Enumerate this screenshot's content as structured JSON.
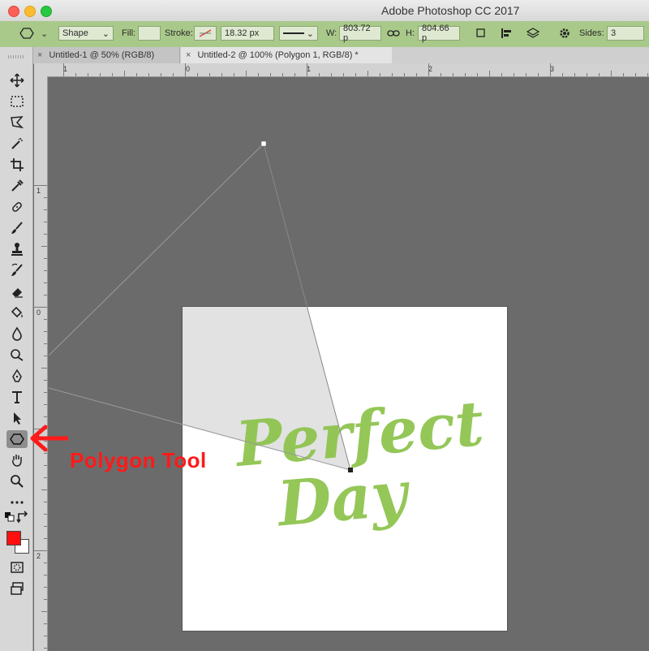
{
  "window": {
    "title": "Adobe Photoshop CC 2017"
  },
  "options_bar": {
    "mode": "Shape",
    "fill_label": "Fill:",
    "stroke_label": "Stroke:",
    "stroke_width": "18.32 px",
    "w_label": "W:",
    "w_value": "803.72 p",
    "h_label": "H:",
    "h_value": "804.66 p",
    "sides_label": "Sides:",
    "sides_value": "3"
  },
  "tabs": [
    {
      "label": "Untitled-1 @ 50% (RGB/8)",
      "close": "×"
    },
    {
      "label": "Untitled-2 @ 100% (Polygon 1, RGB/8) *",
      "close": "×"
    }
  ],
  "ruler": {
    "h_labels": [
      "1",
      "0",
      "1",
      "2",
      "3"
    ],
    "v_labels": [
      "1",
      "0",
      "1",
      "2"
    ]
  },
  "tools": [
    {
      "name": "move-tool-icon"
    },
    {
      "name": "marquee-tool-icon"
    },
    {
      "name": "lasso-tool-icon"
    },
    {
      "name": "magic-wand-tool-icon"
    },
    {
      "name": "crop-tool-icon"
    },
    {
      "name": "eyedropper-tool-icon"
    },
    {
      "name": "healing-brush-tool-icon"
    },
    {
      "name": "brush-tool-icon"
    },
    {
      "name": "stamp-tool-icon"
    },
    {
      "name": "history-brush-tool-icon"
    },
    {
      "name": "eraser-tool-icon"
    },
    {
      "name": "paint-bucket-tool-icon"
    },
    {
      "name": "blur-tool-icon"
    },
    {
      "name": "dodge-tool-icon"
    },
    {
      "name": "pen-tool-icon"
    },
    {
      "name": "type-tool-icon"
    },
    {
      "name": "path-selection-tool-icon"
    },
    {
      "name": "polygon-tool-icon"
    },
    {
      "name": "hand-tool-icon"
    },
    {
      "name": "zoom-tool-icon"
    },
    {
      "name": "more-tools-icon"
    }
  ],
  "colors": {
    "foreground": "#ff1010",
    "background": "#ffffff",
    "options_bar": "#a9c98a",
    "artwork_green": "#8cc34a"
  },
  "canvas_text": {
    "line1": "Perfect",
    "line2": "Day"
  },
  "callout": {
    "label": "Polygon Tool"
  }
}
